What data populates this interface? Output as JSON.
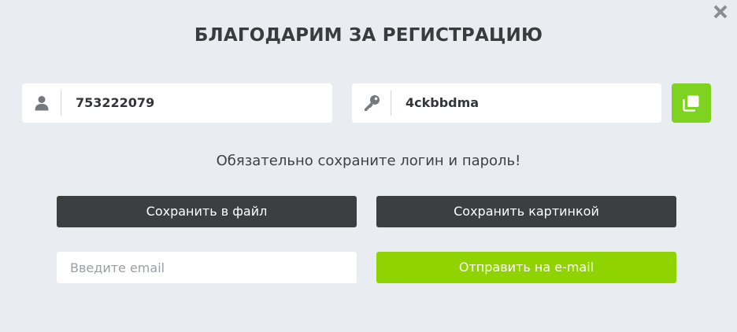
{
  "dialog": {
    "title": "БЛАГОДАРИМ ЗА РЕГИСТРАЦИЮ",
    "close_icon": "close-icon"
  },
  "credentials": {
    "login": {
      "icon": "user-icon",
      "value": "753222079"
    },
    "password": {
      "icon": "key-icon",
      "value": "4ckbbdma"
    },
    "copy_button_icon": "copy-icon"
  },
  "notice": "Обязательно сохраните логин и пароль!",
  "actions": {
    "save_file_label": "Сохранить в файл",
    "save_image_label": "Сохранить картинкой",
    "email_placeholder": "Введите email",
    "send_email_label": "Отправить на e-mail"
  },
  "colors": {
    "background": "#e9edf1",
    "dark_button": "#3d3e40",
    "accent_green": "#8fd400",
    "copy_button": "#7ed321"
  }
}
